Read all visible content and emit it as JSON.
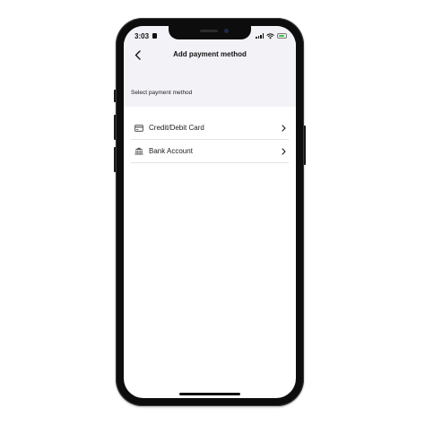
{
  "status_bar": {
    "time": "3:03"
  },
  "nav": {
    "title": "Add payment method"
  },
  "section": {
    "label": "Select payment method"
  },
  "payment_methods": [
    {
      "label": "Credit/Debit Card",
      "icon": "credit-card-icon"
    },
    {
      "label": "Bank Account",
      "icon": "bank-icon"
    }
  ],
  "colors": {
    "header_background": "#f3f2f7",
    "battery": "#33c34a",
    "text": "#222222"
  }
}
